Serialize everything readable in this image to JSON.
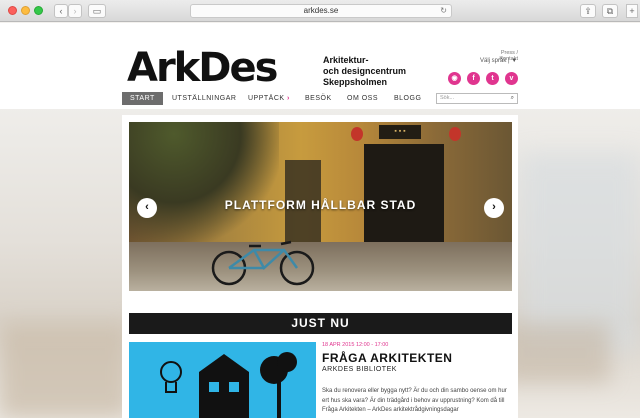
{
  "browser": {
    "url": "arkdes.se"
  },
  "site": {
    "logo": "ArkDes",
    "tagline": [
      "Arkitektur-",
      "och designcentrum",
      "Skeppsholmen"
    ],
    "toplinks": "Press / Kontakt",
    "language": "Välj språk",
    "socials": [
      "rss-icon",
      "facebook-icon",
      "twitter-icon",
      "vimeo-icon"
    ],
    "accent_color": "#e0358f"
  },
  "nav": {
    "items": [
      {
        "label": "START",
        "active": true
      },
      {
        "label": "UTSTÄLLNINGAR"
      },
      {
        "label": "UPPTÄCK"
      },
      {
        "label": "BESÖK"
      },
      {
        "label": "OM OSS"
      },
      {
        "label": "BLOGG"
      }
    ],
    "search_placeholder": "Sök..."
  },
  "hero": {
    "title": "PLATTFORM HÅLLBAR STAD"
  },
  "section": {
    "title": "JUST NU"
  },
  "event": {
    "date": "18 APR 2015 12:00 - 17:00",
    "title": "FRÅGA ARKITEKTEN",
    "subtitle": "ARKDES BIBLIOTEK",
    "body": "Ska du renovera eller bygga nytt? Är du och din sambo oense om hur ert hus ska vara? Är din trädgård i behov av upprustning? Kom då till Fråga Arkitekten – ArkDes arkitektrådgivningsdagar"
  }
}
